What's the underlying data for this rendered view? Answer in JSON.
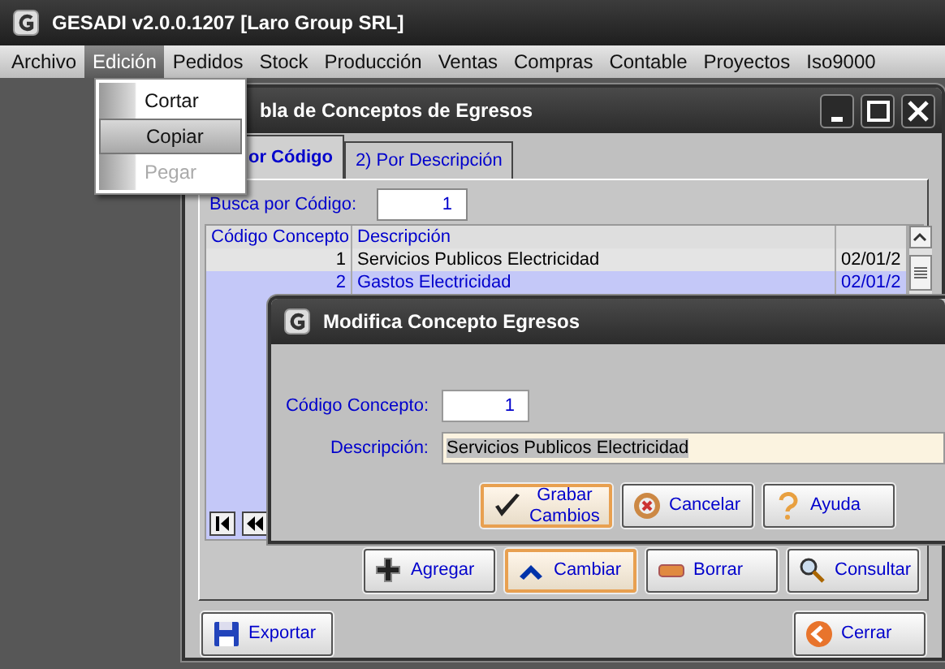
{
  "app_title": "GESADI v2.0.0.1207 [Laro Group SRL]",
  "menu": [
    {
      "label": "Archivo",
      "selected": false
    },
    {
      "label": "Edición",
      "selected": true
    },
    {
      "label": "Pedidos",
      "selected": false
    },
    {
      "label": "Stock",
      "selected": false
    },
    {
      "label": "Producción",
      "selected": false
    },
    {
      "label": "Ventas",
      "selected": false
    },
    {
      "label": "Compras",
      "selected": false
    },
    {
      "label": "Contable",
      "selected": false
    },
    {
      "label": "Proyectos",
      "selected": false
    },
    {
      "label": "Iso9000",
      "selected": false
    }
  ],
  "dropdown": [
    {
      "label": "Cortar",
      "selected": false,
      "disabled": false
    },
    {
      "label": "Copiar",
      "selected": true,
      "disabled": false
    },
    {
      "label": "Pegar",
      "selected": false,
      "disabled": true
    }
  ],
  "main_window": {
    "title": "bla de Conceptos de Egresos",
    "tabs": [
      {
        "label": "or Código",
        "selected": true
      },
      {
        "label": "2) Por Descripción",
        "selected": false
      }
    ],
    "search": {
      "label": "Busca por Código:",
      "value": "1"
    },
    "grid": {
      "columns": [
        "Código Concepto",
        "Descripción"
      ],
      "rows": [
        {
          "cells": [
            "1",
            "Servicios Publicos Electricidad",
            "02/01/2"
          ],
          "selected": false
        },
        {
          "cells": [
            "2",
            "Gastos Electricidad",
            "02/01/2"
          ],
          "selected": true
        }
      ]
    },
    "buttons": [
      {
        "label": "Agregar",
        "kind": "add",
        "focused": false
      },
      {
        "label": "Cambiar",
        "kind": "change",
        "focused": true
      },
      {
        "label": "Borrar",
        "kind": "delete",
        "focused": false
      },
      {
        "label": "Consultar",
        "kind": "search",
        "focused": false
      }
    ],
    "footer_buttons": [
      {
        "label": "Exportar",
        "kind": "save",
        "focused": false
      },
      {
        "label": "Cerrar",
        "kind": "back",
        "focused": false
      }
    ]
  },
  "dialog": {
    "title": "Modifica Concepto Egresos",
    "fields": [
      {
        "label": "Código Concepto:",
        "value": "1",
        "kind": "code"
      },
      {
        "label": "Descripción:",
        "value": "Servicios Publicos Electricidad",
        "kind": "text"
      }
    ],
    "buttons": [
      {
        "label": "Grabar Cambios",
        "kind": "check",
        "focused": true
      },
      {
        "label": "Cancelar",
        "kind": "cancel",
        "focused": false
      },
      {
        "label": "Ayuda",
        "kind": "help",
        "focused": false
      }
    ]
  }
}
